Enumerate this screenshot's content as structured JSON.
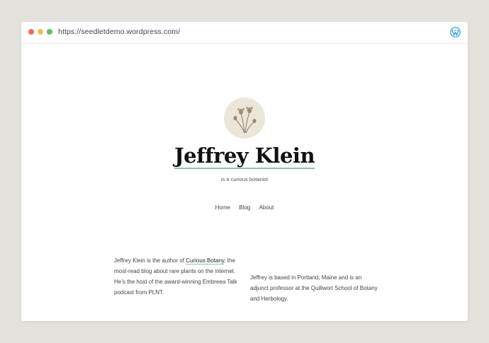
{
  "browser": {
    "url": "https://seedletdemo.wordpress.com/",
    "right_icon": "wordpress-icon"
  },
  "site": {
    "avatar_icon": "dried-flowers-illustration",
    "title": "Jeffrey Klein",
    "tagline": "is a curious botanist"
  },
  "nav": {
    "items": [
      "Home",
      "Blog",
      "About"
    ]
  },
  "content": {
    "left": {
      "before_link": "Jeffrey Klein is the author of ",
      "link": "Curious Botany",
      "after_link": ", the most-read blog about rare plants on the internet. He’s the host of the award-winning Embreea Talk podcast from PLNT."
    },
    "right": "Jeffrey is based in Portland, Maine and is an adjunct professor at the Quillwort School of Botany and Herbology."
  },
  "colors": {
    "background": "#e3e1dc",
    "accent_underline": "#8fbfb5",
    "wordpress_blue": "#2fa0d8"
  }
}
